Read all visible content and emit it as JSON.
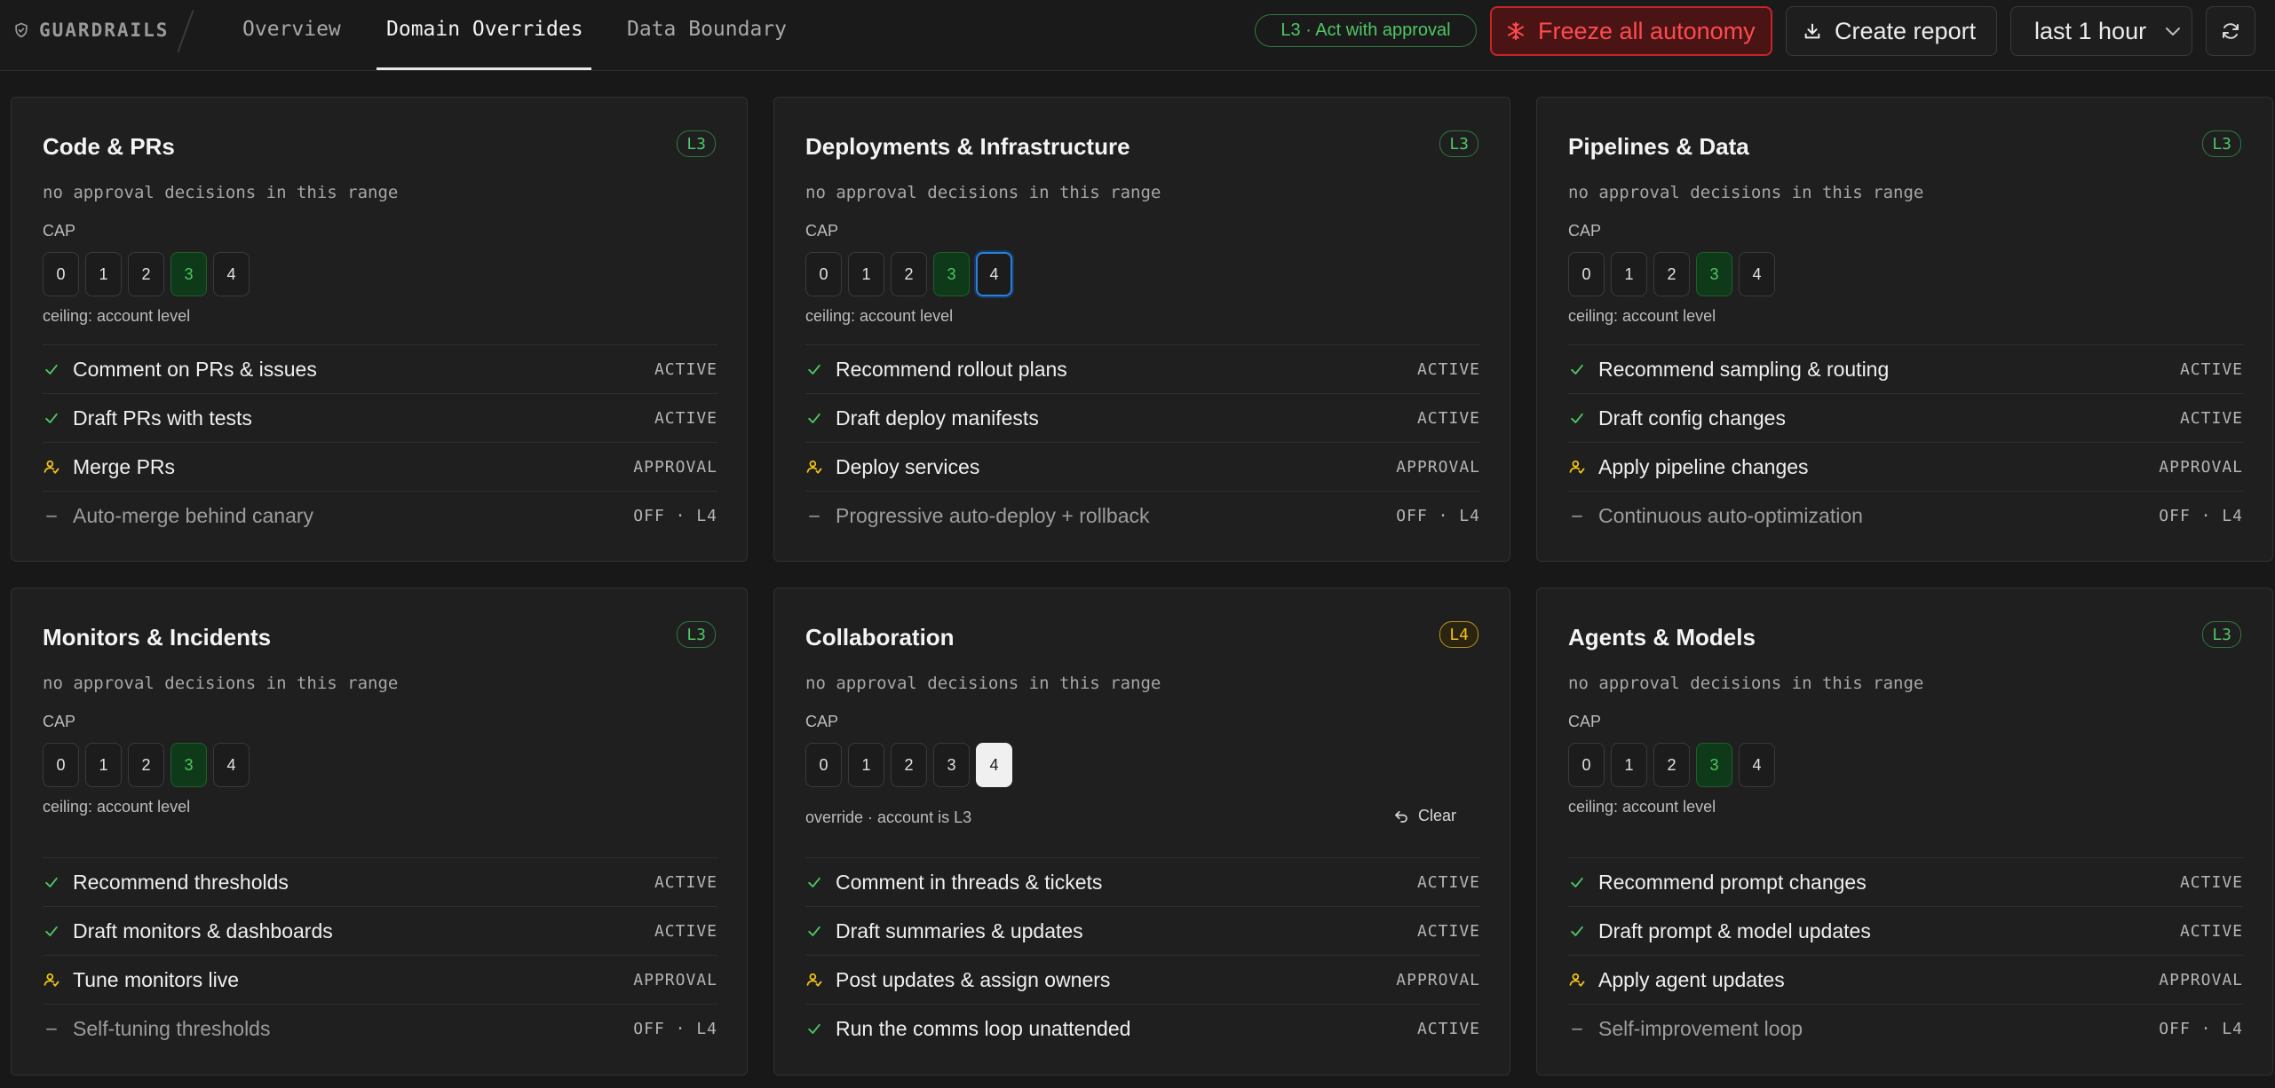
{
  "brand": {
    "name": "GUARDRAILS",
    "icon": "shield-icon"
  },
  "tabs": [
    {
      "label": "Overview"
    },
    {
      "label": "Domain Overrides"
    },
    {
      "label": "Data Boundary"
    }
  ],
  "header": {
    "level_pill": "L3 · Act with approval",
    "freeze_label": "Freeze all autonomy",
    "report_label": "Create report",
    "range_label": "last 1 hour"
  },
  "colors": {
    "background": "#181818",
    "card": "#1f1f1f",
    "green": "#4ec764",
    "amber": "#f0c419",
    "danger": "#ff4a4f",
    "focus": "#2f7fd6"
  },
  "cards": [
    {
      "title": "Code & PRs",
      "level": "L3",
      "no_approval": "no approval decisions in this range",
      "cap_label": "CAP",
      "cap_levels": [
        "0",
        "1",
        "2",
        "3",
        "4"
      ],
      "ceiling": "ceiling: account level",
      "capabilities": [
        {
          "name": "Comment on PRs & issues",
          "status": "ACTIVE"
        },
        {
          "name": "Draft PRs with tests",
          "status": "ACTIVE"
        },
        {
          "name": "Merge PRs",
          "status": "APPROVAL"
        },
        {
          "name": "Auto-merge behind canary",
          "status": "OFF · L4"
        }
      ]
    },
    {
      "title": "Deployments & Infrastructure",
      "level": "L3",
      "no_approval": "no approval decisions in this range",
      "cap_label": "CAP",
      "cap_levels": [
        "0",
        "1",
        "2",
        "3",
        "4"
      ],
      "ceiling": "ceiling: account level",
      "capabilities": [
        {
          "name": "Recommend rollout plans",
          "status": "ACTIVE"
        },
        {
          "name": "Draft deploy manifests",
          "status": "ACTIVE"
        },
        {
          "name": "Deploy services",
          "status": "APPROVAL"
        },
        {
          "name": "Progressive auto-deploy + rollback",
          "status": "OFF · L4"
        }
      ]
    },
    {
      "title": "Pipelines & Data",
      "level": "L3",
      "no_approval": "no approval decisions in this range",
      "cap_label": "CAP",
      "cap_levels": [
        "0",
        "1",
        "2",
        "3",
        "4"
      ],
      "ceiling": "ceiling: account level",
      "capabilities": [
        {
          "name": "Recommend sampling & routing",
          "status": "ACTIVE"
        },
        {
          "name": "Draft config changes",
          "status": "ACTIVE"
        },
        {
          "name": "Apply pipeline changes",
          "status": "APPROVAL"
        },
        {
          "name": "Continuous auto-optimization",
          "status": "OFF · L4"
        }
      ]
    },
    {
      "title": "Monitors & Incidents",
      "level": "L3",
      "no_approval": "no approval decisions in this range",
      "cap_label": "CAP",
      "cap_levels": [
        "0",
        "1",
        "2",
        "3",
        "4"
      ],
      "ceiling": "ceiling: account level",
      "capabilities": [
        {
          "name": "Recommend thresholds",
          "status": "ACTIVE"
        },
        {
          "name": "Draft monitors & dashboards",
          "status": "ACTIVE"
        },
        {
          "name": "Tune monitors live",
          "status": "APPROVAL"
        },
        {
          "name": "Self-tuning thresholds",
          "status": "OFF · L4"
        }
      ]
    },
    {
      "title": "Collaboration",
      "level": "L4",
      "no_approval": "no approval decisions in this range",
      "cap_label": "CAP",
      "cap_levels": [
        "0",
        "1",
        "2",
        "3",
        "4"
      ],
      "override": "override · account is L3",
      "clear_label": "Clear",
      "capabilities": [
        {
          "name": "Comment in threads & tickets",
          "status": "ACTIVE"
        },
        {
          "name": "Draft summaries & updates",
          "status": "ACTIVE"
        },
        {
          "name": "Post updates & assign owners",
          "status": "APPROVAL"
        },
        {
          "name": "Run the comms loop unattended",
          "status": "ACTIVE"
        }
      ]
    },
    {
      "title": "Agents & Models",
      "level": "L3",
      "no_approval": "no approval decisions in this range",
      "cap_label": "CAP",
      "cap_levels": [
        "0",
        "1",
        "2",
        "3",
        "4"
      ],
      "ceiling": "ceiling: account level",
      "capabilities": [
        {
          "name": "Recommend prompt changes",
          "status": "ACTIVE"
        },
        {
          "name": "Draft prompt & model updates",
          "status": "ACTIVE"
        },
        {
          "name": "Apply agent updates",
          "status": "APPROVAL"
        },
        {
          "name": "Self-improvement loop",
          "status": "OFF · L4"
        }
      ]
    }
  ]
}
